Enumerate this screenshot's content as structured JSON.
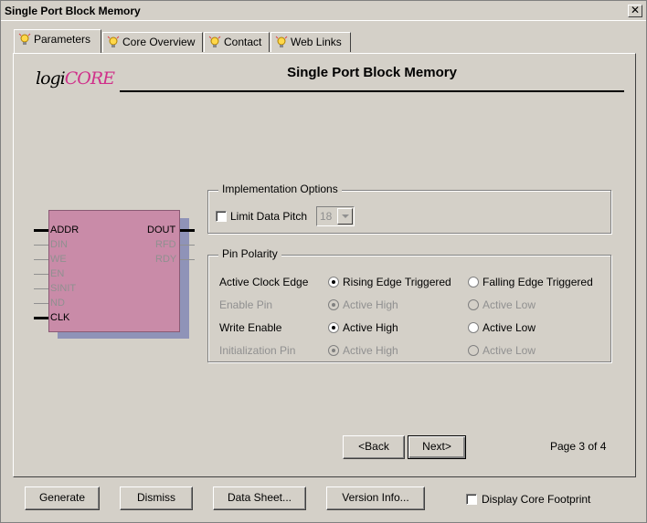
{
  "window": {
    "title": "Single Port Block Memory"
  },
  "titlebar": {
    "close_glyph": "✕"
  },
  "tabs": [
    {
      "label": "Parameters",
      "icon": "lightbulb-icon",
      "active": true
    },
    {
      "label": "Core Overview",
      "icon": "lightbulb-icon",
      "active": false
    },
    {
      "label": "Contact",
      "icon": "lightbulb-icon",
      "active": false
    },
    {
      "label": "Web Links",
      "icon": "lightbulb-icon",
      "active": false
    }
  ],
  "header": {
    "logo_part1": "logi",
    "logo_part2": "CORE",
    "title": "Single Port Block Memory"
  },
  "symbol": {
    "left_pins": [
      {
        "name": "ADDR",
        "active": true
      },
      {
        "name": "DIN",
        "active": false
      },
      {
        "name": "WE",
        "active": false
      },
      {
        "name": "EN",
        "active": false
      },
      {
        "name": "SINIT",
        "active": false
      },
      {
        "name": "ND",
        "active": false
      },
      {
        "name": "CLK",
        "active": true
      }
    ],
    "right_pins": [
      {
        "name": "DOUT",
        "active": true
      },
      {
        "name": "RFD",
        "active": false
      },
      {
        "name": "RDY",
        "active": false
      }
    ],
    "fill_color": "#c98ba8",
    "shadow_color": "#8f93b8"
  },
  "implementation": {
    "legend": "Implementation Options",
    "limit_pitch_label": "Limit Data Pitch",
    "limit_pitch_checked": false,
    "pitch_value": "18"
  },
  "polarity": {
    "legend": "Pin Polarity",
    "rows": [
      {
        "label": "Active Clock Edge",
        "opt1": "Rising Edge Triggered",
        "opt2": "Falling Edge Triggered",
        "enabled": true
      },
      {
        "label": "Enable Pin",
        "opt1": "Active High",
        "opt2": "Active Low",
        "enabled": false
      },
      {
        "label": "Write Enable",
        "opt1": "Active High",
        "opt2": "Active Low",
        "enabled": true
      },
      {
        "label": "Initialization Pin",
        "opt1": "Active High",
        "opt2": "Active Low",
        "enabled": false
      }
    ]
  },
  "nav": {
    "back_label": "<Back",
    "next_label": "Next>",
    "page_indicator": "Page 3 of 4"
  },
  "footer": {
    "generate_label": "Generate",
    "dismiss_label": "Dismiss",
    "datasheet_label": "Data Sheet...",
    "version_label": "Version Info...",
    "footprint_label": "Display Core Footprint",
    "footprint_checked": false
  }
}
